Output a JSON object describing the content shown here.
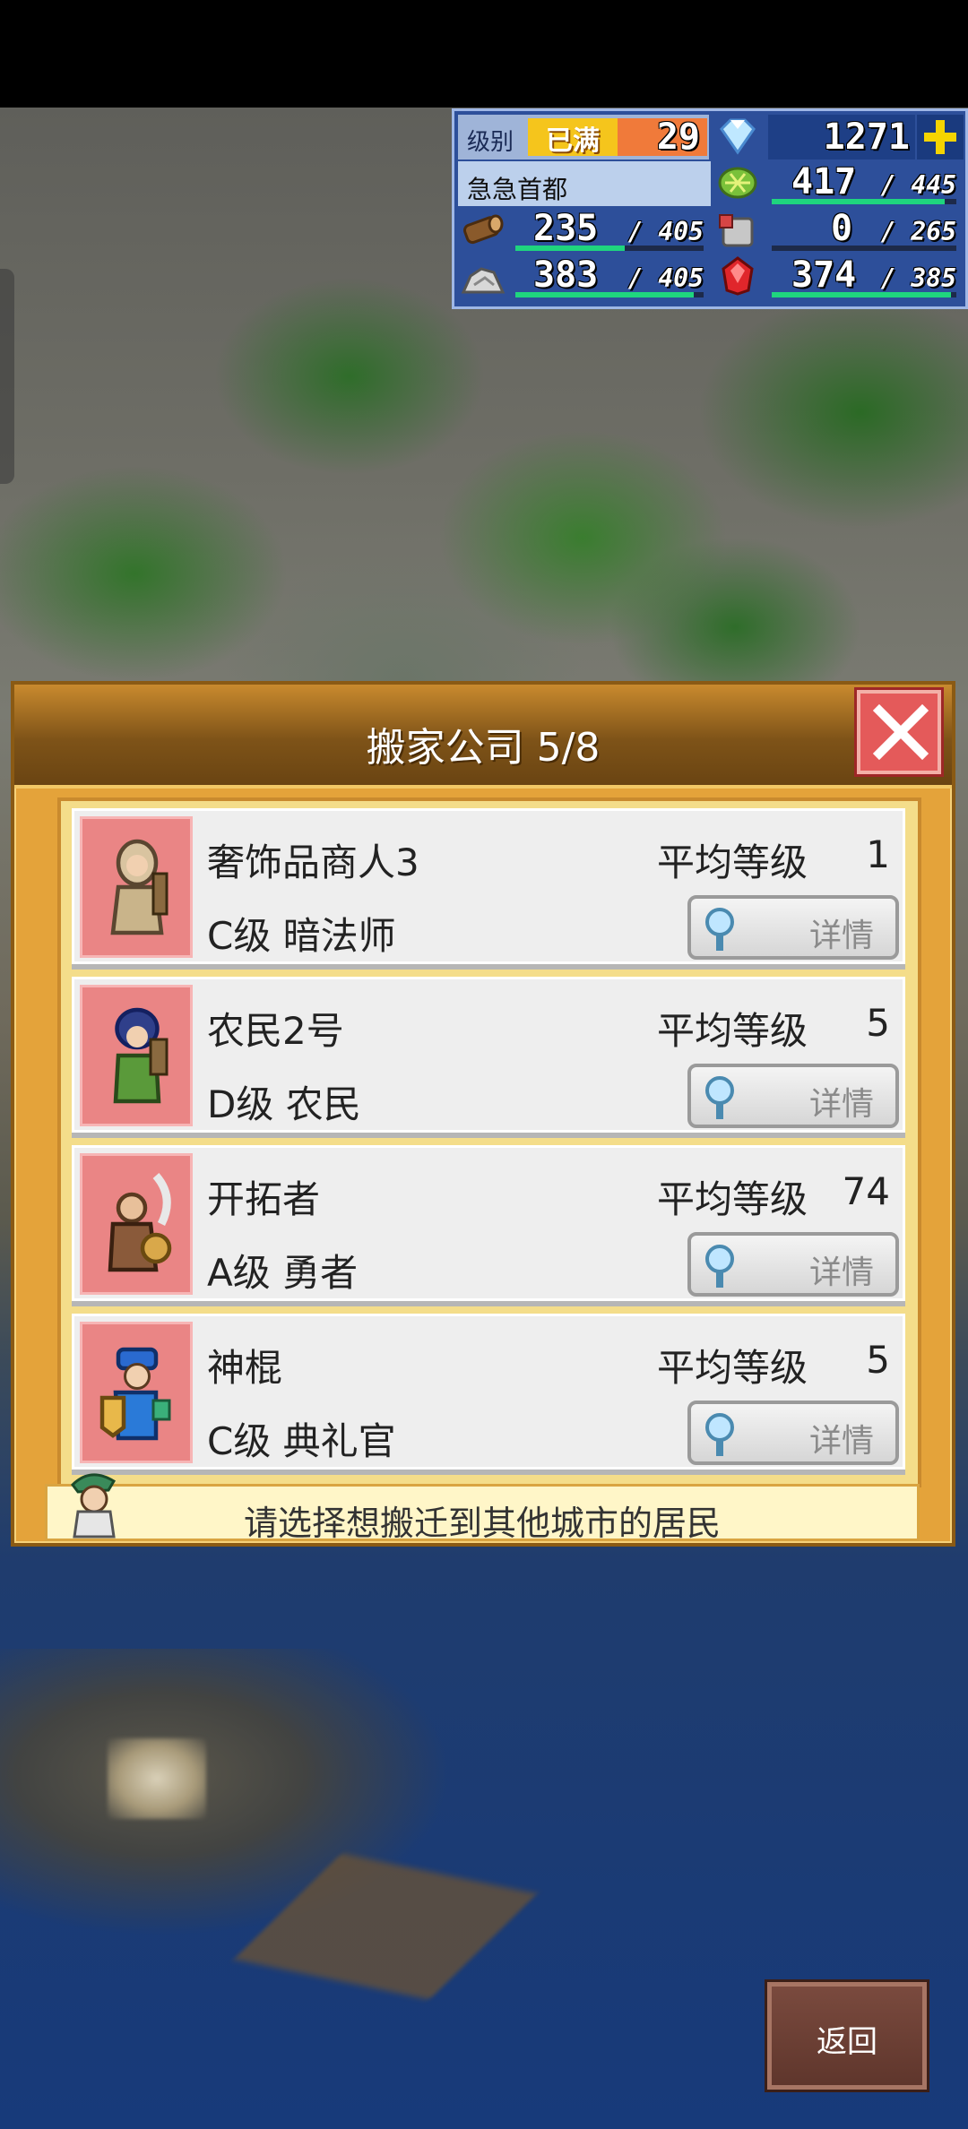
{
  "hud": {
    "level_label": "级别",
    "level_badge": "已满",
    "level_value": "29",
    "gems": "1271",
    "city_name": "急急首都",
    "food_value": "417",
    "food_max": "/ 445",
    "food_fill": 0.937,
    "wood_value": "235",
    "wood_max": "/ 405",
    "wood_fill": 0.58,
    "armor_value": "0",
    "armor_max": "/ 265",
    "armor_fill": 0,
    "stone_value": "383",
    "stone_max": "/ 405",
    "stone_fill": 0.946,
    "ruby_value": "374",
    "ruby_max": "/ 385",
    "ruby_fill": 0.971,
    "colors": {
      "panel": "#2d4f9a",
      "bar": "#1fd57e",
      "badge": "#f08a2a",
      "plus": "#f5d400"
    }
  },
  "dialog": {
    "title": "搬家公司 5/8",
    "hint": "请选择想搬迁到其他城市的居民",
    "rows": [
      {
        "name": "奢饰品商人3",
        "class": "C级 暗法师",
        "level_label": "平均等级",
        "level": "1",
        "detail": "详情"
      },
      {
        "name": "农民2号",
        "class": "D级 农民",
        "level_label": "平均等级",
        "level": "5",
        "detail": "详情"
      },
      {
        "name": "开拓者",
        "class": "A级 勇者",
        "level_label": "平均等级",
        "level": "74",
        "detail": "详情"
      },
      {
        "name": "神棍",
        "class": "C级 典礼官",
        "level_label": "平均等级",
        "level": "5",
        "detail": "详情"
      }
    ]
  },
  "back_label": "返回"
}
